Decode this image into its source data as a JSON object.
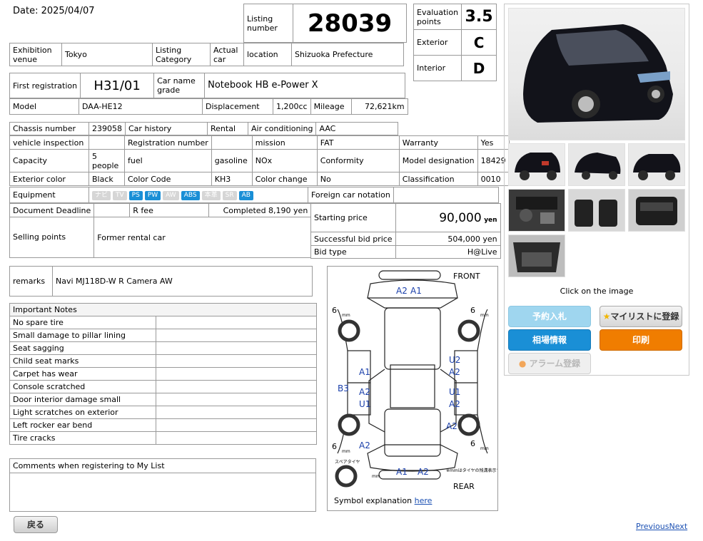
{
  "header": {
    "date": "Date: 2025/04/07",
    "listing_number_label": "Listing number",
    "listing_number": "28039"
  },
  "evaluation": {
    "points_label": "Evaluation points",
    "points": "3.5",
    "exterior_label": "Exterior",
    "exterior": "C",
    "interior_label": "Interior",
    "interior": "D"
  },
  "venue": {
    "exhibition_label": "Exhibition venue",
    "exhibition": "Tokyo",
    "category_label": "Listing Category",
    "actual_label": "Actual car",
    "location_label": "location",
    "location": "Shizuoka Prefecture"
  },
  "registration": {
    "first_label": "First registration",
    "first": "H31/01",
    "name_label": "Car name grade",
    "name": "Notebook HB e-Power X"
  },
  "model": {
    "label": "Model",
    "value": "DAA-HE12",
    "displacement_label": "Displacement",
    "displacement": "1,200cc",
    "mileage_label": "Mileage",
    "mileage": "72,621km"
  },
  "specs": {
    "chassis_label": "Chassis number",
    "chassis": "239058",
    "history_label": "Car history",
    "history": "Rental",
    "ac_label": "Air conditioning",
    "ac": "AAC",
    "inspection_label": "vehicle inspection",
    "regnum_label": "Registration number",
    "mission_label": "mission",
    "mission": "FAT",
    "warranty_label": "Warranty",
    "warranty": "Yes",
    "capacity_label": "Capacity",
    "capacity": "5 people",
    "fuel_label": "fuel",
    "fuel": "gasoline",
    "nox_label": "NOx",
    "conformity_label": "Conformity",
    "model_designation_label": "Model designation",
    "model_designation": "18429",
    "ext_color_label": "Exterior color",
    "ext_color": "Black",
    "color_code_label": "Color Code",
    "color_code": "KH3",
    "color_change_label": "Color change",
    "color_change": "No",
    "classification_label": "Classification",
    "classification": "0010",
    "equipment_label": "Equipment",
    "equipment": [
      {
        "name": "ナビ",
        "on": false
      },
      {
        "name": "TV",
        "on": false
      },
      {
        "name": "PS",
        "on": true
      },
      {
        "name": "PW",
        "on": true
      },
      {
        "name": "AW",
        "on": false
      },
      {
        "name": "ABS",
        "on": true
      },
      {
        "name": "本革",
        "on": false
      },
      {
        "name": "SR",
        "on": false
      },
      {
        "name": "AB",
        "on": true
      }
    ],
    "foreign_label": "Foreign car notation",
    "doc_deadline_label": "Document Deadline",
    "rfee_label": "R fee",
    "rfee": "Completed 8,190 yen",
    "starting_price_label": "Starting price",
    "starting_price": "90,000",
    "yen": "yen",
    "selling_points_label": "Selling points",
    "selling_points": "Former rental car",
    "bid_price_label": "Successful bid price",
    "bid_price": "504,000 yen",
    "bid_type_label": "Bid type",
    "bid_type": "H@Live"
  },
  "remarks": {
    "label": "remarks",
    "value": "Navi MJ118D-W R Camera AW"
  },
  "notes": {
    "title": "Important Notes",
    "items": [
      "No spare tire",
      "Small damage to pillar lining",
      "Seat sagging",
      "Child seat marks",
      "Carpet has wear",
      "Console scratched",
      "Door interior damage small",
      "Light scratches on exterior",
      "Left rocker ear bend",
      "Tire cracks"
    ]
  },
  "comments": {
    "label": "Comments when registering to My List"
  },
  "diagram": {
    "front": "FRONT",
    "rear": "REAR",
    "spare": "スペアタイヤ",
    "mm_note": "※mmはタイヤの残溝表示です",
    "symbol_label": "Symbol explanation",
    "symbol_link": "here",
    "tire_top_left": "6",
    "tire_top_right": "6",
    "tire_bottom_left": "6",
    "tire_bottom_right": "6",
    "mm": "mm",
    "marks": {
      "front_a2": "A2",
      "front_a1": "A1",
      "left1": "A1",
      "left_b3": "B3",
      "left2": "A2",
      "left3": "U1",
      "left4": "A2",
      "right1": "U2",
      "right2": "A2",
      "right3": "U1",
      "right4": "A2",
      "right5": "A2",
      "rear_a1": "A1",
      "rear_a2": "A2"
    }
  },
  "gallery": {
    "click_text": "Click on the image"
  },
  "buttons": {
    "reserve_bid": "予約入札",
    "mylist": "マイリストに登録",
    "market": "相場情報",
    "print": "印刷",
    "alarm": "アラーム登録",
    "back": "戻る"
  },
  "pager": {
    "previous": "Previous",
    "next": "Next"
  },
  "colors": {
    "blue_btn": "#1a8fd6",
    "orange_btn": "#f07d00",
    "link": "#1b50b3"
  }
}
